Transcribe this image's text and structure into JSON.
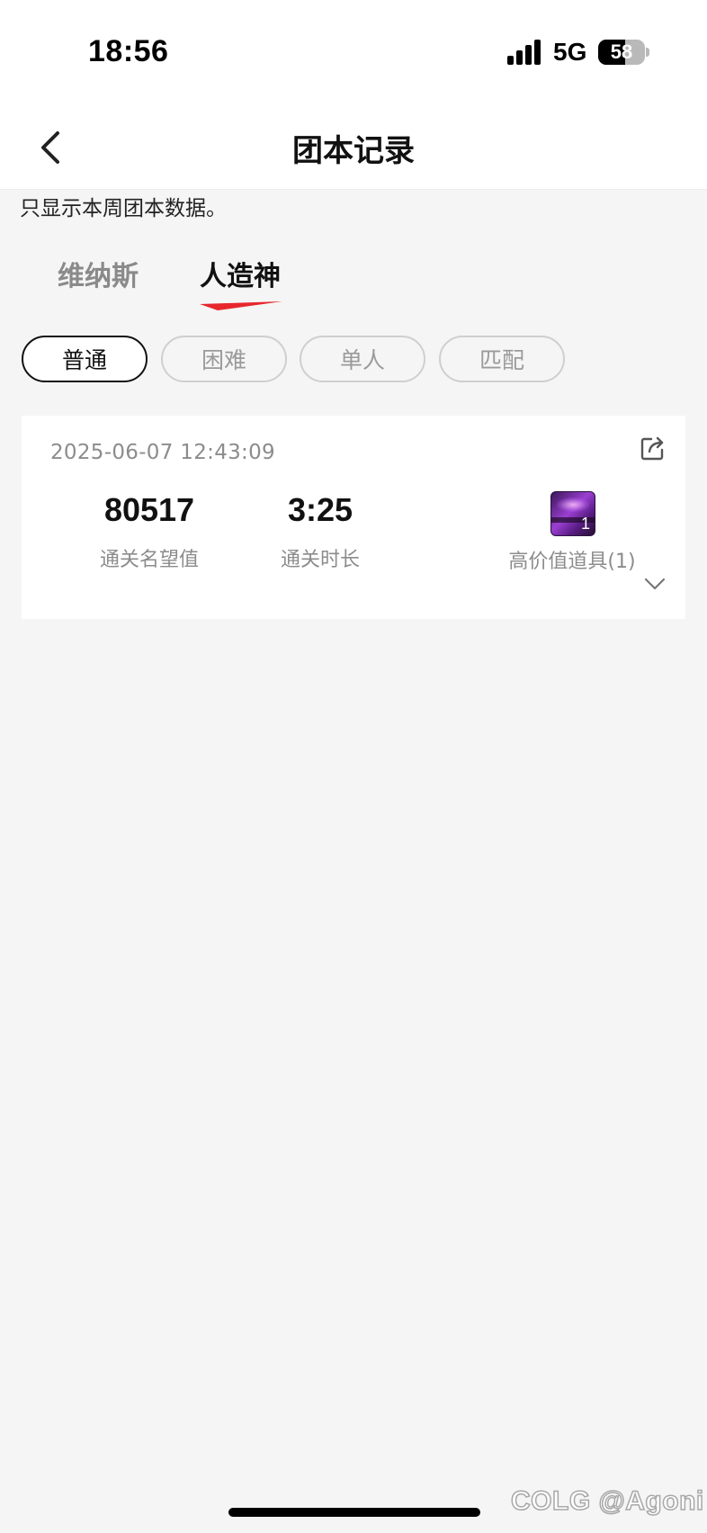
{
  "status_bar": {
    "time": "18:56",
    "network": "5G",
    "battery_level": "58"
  },
  "nav": {
    "title": "团本记录"
  },
  "notice": "只显示本周团本数据。",
  "tabs": [
    {
      "label": "维纳斯",
      "active": false
    },
    {
      "label": "人造神",
      "active": true
    }
  ],
  "filters": [
    {
      "label": "普通",
      "active": true
    },
    {
      "label": "困难",
      "active": false
    },
    {
      "label": "单人",
      "active": false
    },
    {
      "label": "匹配",
      "active": false
    }
  ],
  "records": [
    {
      "datetime": "2025-06-07 12:43:09",
      "reputation_value": "80517",
      "reputation_label": "通关名望值",
      "duration_value": "3:25",
      "duration_label": "通关时长",
      "item_count": "1",
      "item_label": "高价值道具(1)"
    }
  ],
  "watermark": "COLG @Agoni",
  "colors": {
    "background": "#f5f5f5",
    "accent_red": "#e8262d",
    "muted_text": "#8c8c8c"
  }
}
